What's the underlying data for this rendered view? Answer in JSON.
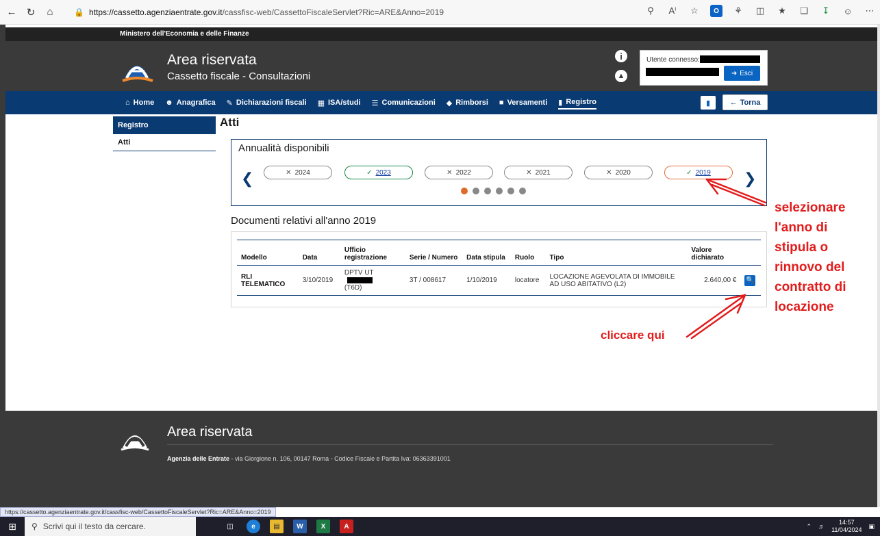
{
  "browser": {
    "url_host": "https://cassetto.agenziaentrate.gov.it",
    "url_path": "/cassfisc-web/CassettoFiscaleServlet?Ric=ARE&Anno=2019",
    "icons": [
      "back-icon",
      "refresh-icon",
      "home-icon",
      "zoom-icon",
      "read-aloud-icon",
      "favorite-icon",
      "outlook-icon",
      "extensions-icon",
      "split-icon",
      "favorites-icon",
      "collections-icon",
      "download-icon",
      "profile-icon",
      "menu-icon"
    ]
  },
  "site": {
    "ministry": "Ministero dell'Economia e delle Finanze",
    "title": "Area riservata",
    "subtitle": "Cassetto fiscale - Consultazioni",
    "user_label": "Utente connesso:",
    "logout_label": "Esci",
    "back_label": "Torna"
  },
  "nav": {
    "items": [
      {
        "label": "Home",
        "icon": "home-icon"
      },
      {
        "label": "Anagrafica",
        "icon": "users-icon"
      },
      {
        "label": "Dichiarazioni fiscali",
        "icon": "edit-icon"
      },
      {
        "label": "ISA/studi",
        "icon": "calculator-icon"
      },
      {
        "label": "Comunicazioni",
        "icon": "file-icon"
      },
      {
        "label": "Rimborsi",
        "icon": "money-icon"
      },
      {
        "label": "Versamenti",
        "icon": "briefcase-icon"
      },
      {
        "label": "Registro",
        "icon": "book-icon"
      }
    ],
    "active": "Registro"
  },
  "sidebar": {
    "registro": "Registro",
    "atti": "Atti"
  },
  "main": {
    "title": "Atti",
    "years_title": "Annualità disponibili",
    "years": [
      {
        "label": "2024",
        "available": false
      },
      {
        "label": "2023",
        "available": true
      },
      {
        "label": "2022",
        "available": false
      },
      {
        "label": "2021",
        "available": false
      },
      {
        "label": "2020",
        "available": false
      },
      {
        "label": "2019",
        "available": true,
        "selected": true
      }
    ],
    "carousel_pages": 6,
    "carousel_active": 1,
    "docs_title": "Documenti relativi all'anno 2019",
    "table": {
      "headers": [
        "Modello",
        "Data",
        "Ufficio registrazione",
        "Serie / Numero",
        "Data stipula",
        "Ruolo",
        "Tipo",
        "Valore dichiarato"
      ],
      "rows": [
        {
          "modello": "RLI TELEMATICO",
          "data": "3/10/2019",
          "ufficio_a": "DPTV UT",
          "ufficio_b": "(T6D)",
          "serie": "3T / 008617",
          "stipula": "1/10/2019",
          "ruolo": "locatore",
          "tipo": "LOCAZIONE AGEVOLATA DI IMMOBILE AD USO ABITATIVO (L2)",
          "valore": "2.640,00 €"
        }
      ]
    }
  },
  "annotations": {
    "right_lines": [
      "selezionare",
      "l'anno di",
      "stipula o",
      "rinnovo del",
      "contratto di",
      "locazione"
    ],
    "click": "cliccare qui",
    "color": "#e21c1c"
  },
  "footer": {
    "title": "Area riservata",
    "org": "Agenzia delle Entrate",
    "address": " - via Giorgione n. 106, 00147 Roma - Codice Fiscale e Partita Iva: 06363391001"
  },
  "status_url": "https://cassetto.agenziaentrate.gov.it/cassfisc-web/CassettoFiscaleServlet?Ric=ARE&Anno=2019",
  "taskbar": {
    "search_placeholder": "Scrivi qui il testo da cercare.",
    "time": "14:57",
    "date": "11/04/2024"
  }
}
